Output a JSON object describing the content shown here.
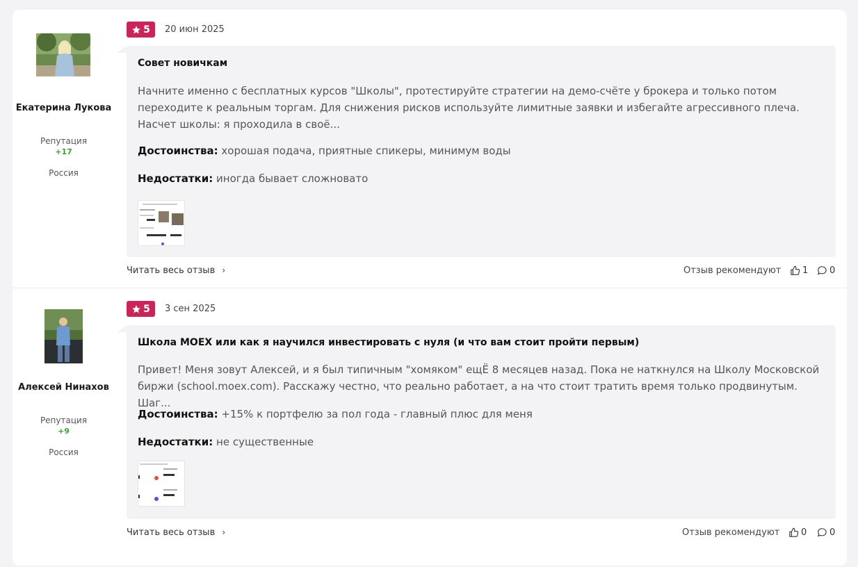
{
  "reviews": [
    {
      "author": {
        "name": "Екатерина Лукова",
        "reputation_label": "Репутация",
        "reputation_value": "+17",
        "country": "Россия"
      },
      "rating": "5",
      "date": "20 июн 2025",
      "title": "Совет новичкам",
      "text": "Начните именно с бесплатных курсов \"Школы\", протестируйте стратегии на демо-счёте у брокера и только потом переходите к реальным торгам. Для снижения рисков используйте лимитные заявки и избегайте агрессивного плеча. Насчет школы: я проходила в своё...",
      "pros_label": "Достоинства:",
      "pros": "хорошая подача, приятные спикеры, минимум воды",
      "cons_label": "Недостатки:",
      "cons": "иногда бывает сложновато",
      "read_more": "Читать весь отзыв",
      "recommend_label": "Отзыв рекомендуют",
      "likes": "1",
      "comments": "0"
    },
    {
      "author": {
        "name": "Алексей Нинахов",
        "reputation_label": "Репутация",
        "reputation_value": "+9",
        "country": "Россия"
      },
      "rating": "5",
      "date": "3 сен 2025",
      "title": "Школа MOEX или как я научился инвестировать с нуля (и что вам стоит пройти первым)",
      "text": "Привет! Меня зовут Алексей, и я был типичным \"хомяком\" ещЁ 8 месяцев назад. Пока не наткнулся на Школу Московской биржи (school.moex.com). Расскажу честно, что реально работает, а на что стоит тратить время только продвинутым. Шаг...",
      "pros_label": "Достоинства:",
      "pros": "+15% к портфелю за пол года - главный плюс для меня",
      "cons_label": "Недостатки:",
      "cons": "не существенные",
      "read_more": "Читать весь отзыв",
      "recommend_label": "Отзыв рекомендуют",
      "likes": "0",
      "comments": "0"
    }
  ],
  "colors": {
    "rating_badge": "#c8265a",
    "reputation": "#3aa13a",
    "review_bg": "#f3f3f5"
  },
  "icons": {
    "star": "star-icon",
    "chevron": "chevron-right-icon",
    "like": "thumbs-up-icon",
    "comment": "comment-icon"
  }
}
